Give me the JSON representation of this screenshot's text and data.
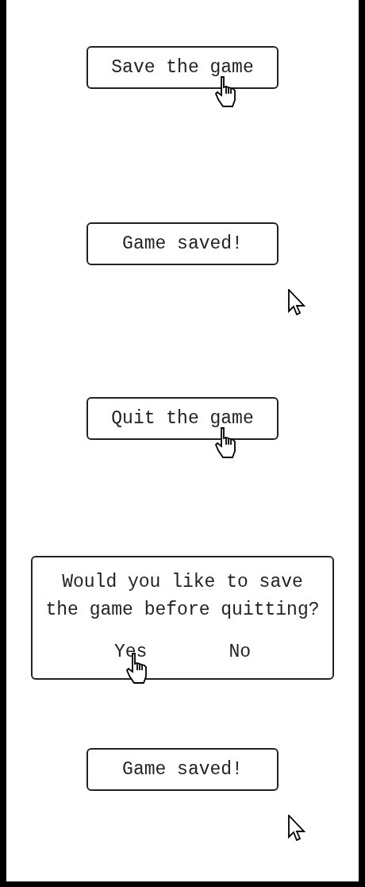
{
  "panels": [
    {
      "kind": "button",
      "text": "Save the game",
      "cursor": {
        "kind": "hand"
      }
    },
    {
      "kind": "message",
      "text": "Game saved!",
      "cursor": {
        "kind": "arrow"
      }
    },
    {
      "kind": "button",
      "text": "Quit the game",
      "cursor": {
        "kind": "hand"
      }
    },
    {
      "kind": "dialog",
      "question": "Would you like to save the game before quitting?",
      "buttons": [
        "Yes",
        "No"
      ],
      "cursor": {
        "kind": "hand"
      }
    },
    {
      "kind": "message",
      "text": "Game saved!",
      "cursor": {
        "kind": "arrow"
      }
    }
  ]
}
